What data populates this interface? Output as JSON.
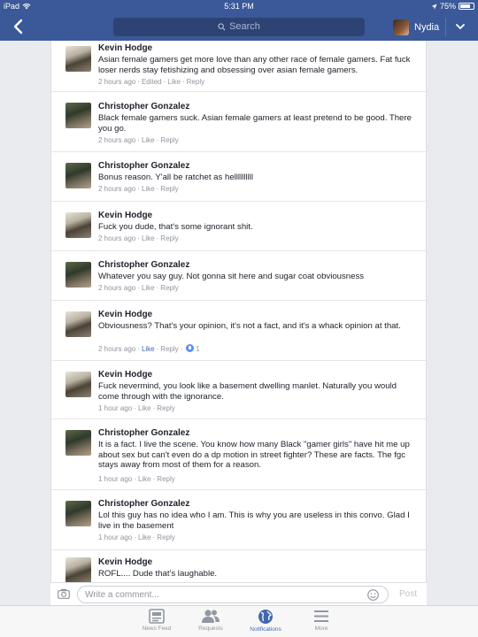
{
  "status_bar": {
    "device": "iPad",
    "time": "5:31 PM",
    "battery": "75%",
    "battery_level": 0.75
  },
  "nav": {
    "search_placeholder": "Search",
    "user_name": "Nydia"
  },
  "comments": [
    {
      "author": "Kevin Hodge",
      "text": "Asian female gamers get more love than any other race of female gamers. Fat fuck loser nerds stay fetishizing and obsessing over asian female gamers.",
      "time": "2 hours ago",
      "edited": "Edited",
      "like": "Like",
      "reply": "Reply"
    },
    {
      "author": "Christopher Gonzalez",
      "text": "Black female gamers suck. Asian female gamers at least pretend to be good. There you go.",
      "time": "2 hours ago",
      "like": "Like",
      "reply": "Reply"
    },
    {
      "author": "Christopher Gonzalez",
      "text": "Bonus reason. Y'all be ratchet as hellllllllll",
      "time": "2 hours ago",
      "like": "Like",
      "reply": "Reply"
    },
    {
      "author": "Kevin Hodge",
      "text": "Fuck you dude, that's some ignorant shit.",
      "time": "2 hours ago",
      "like": "Like",
      "reply": "Reply"
    },
    {
      "author": "Christopher Gonzalez",
      "text": "Whatever you say guy. Not gonna sit here and sugar coat obviousness",
      "time": "2 hours ago",
      "like": "Like",
      "reply": "Reply"
    },
    {
      "author": "Kevin Hodge",
      "text": "Obviousness? That's your opinion, it's not a fact, and it's a whack opinion at that.",
      "time": "2 hours ago",
      "like": "Like",
      "reply": "Reply",
      "reactions": "1"
    },
    {
      "author": "Kevin Hodge",
      "text": "Fuck nevermind, you look like a basement dwelling manlet. Naturally you would come through with the ignorance.",
      "time": "1 hour ago",
      "like": "Like",
      "reply": "Reply"
    },
    {
      "author": "Christopher Gonzalez",
      "text": "It is a fact. I live the scene. You know how many Black \"gamer girls\" have hit me up about sex but can't even do a dp motion in street fighter? These are facts. The fgc stays away from most of them for a reason.",
      "time": "1 hour ago",
      "like": "Like",
      "reply": "Reply"
    },
    {
      "author": "Christopher Gonzalez",
      "text": "Lol this guy has no idea who I am. This is why you are useless in this convo. Glad I live in the basement",
      "time": "1 hour ago",
      "like": "Like",
      "reply": "Reply"
    },
    {
      "author": "Kevin Hodge",
      "text": "ROFL.... Dude that's laughable.",
      "time": "",
      "like": "",
      "reply": ""
    }
  ],
  "composer": {
    "placeholder": "Write a comment...",
    "post_label": "Post"
  },
  "tabs": [
    {
      "label": "News Feed",
      "icon": "news-feed-icon"
    },
    {
      "label": "Requests",
      "icon": "friend-requests-icon"
    },
    {
      "label": "Notifications",
      "icon": "globe-icon",
      "active": true
    },
    {
      "label": "More",
      "icon": "menu-icon"
    }
  ],
  "colors": {
    "brand": "#3b5998",
    "link_active": "#4267b2",
    "meta_gray": "#90949c"
  }
}
